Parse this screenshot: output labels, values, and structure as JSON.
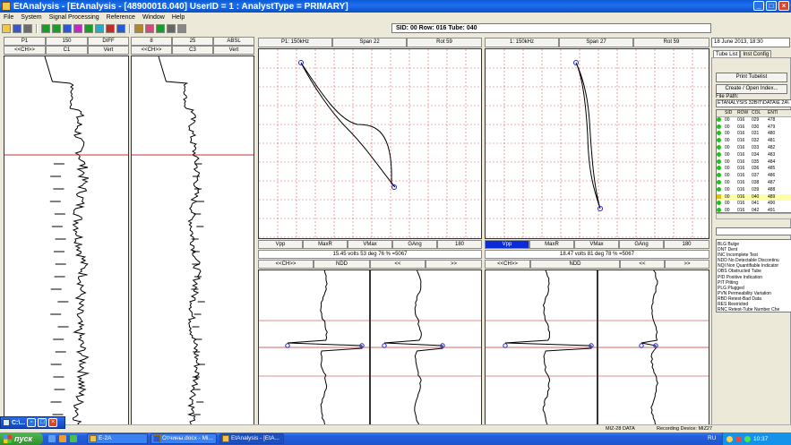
{
  "window": {
    "title": "EtAnalysis - [EtAnalysis - [48900016.040]      UserID = 1 : AnalystType = PRIMARY]",
    "min": "_",
    "max": "□",
    "close": "×"
  },
  "menu": [
    "File",
    "System",
    "Signal Processing",
    "Reference",
    "Window",
    "Help"
  ],
  "toolbar_icons": [
    {
      "name": "open-icon",
      "color": "#f2c84a"
    },
    {
      "name": "save-icon",
      "color": "#3a57c2"
    },
    {
      "name": "print-icon",
      "color": "#6b6b6b"
    },
    {
      "name": "config-c-icon",
      "color": "#1b9c2a"
    },
    {
      "name": "config-d-icon",
      "color": "#1b9c2a"
    },
    {
      "name": "config-h-icon",
      "color": "#2a59d6"
    },
    {
      "name": "config-m-icon",
      "color": "#c22bc2"
    },
    {
      "name": "filter-l-icon",
      "color": "#1b9c2a"
    },
    {
      "name": "filter-s-icon",
      "color": "#2aa9c4"
    },
    {
      "name": "filter-r-icon",
      "color": "#c22b2b"
    },
    {
      "name": "mix-icon",
      "color": "#2a59d6"
    },
    {
      "name": "chart-icon",
      "color": "#b8862a"
    },
    {
      "name": "palette-icon",
      "color": "#d24a7a"
    },
    {
      "name": "grid-icon",
      "color": "#1b9c2a"
    },
    {
      "name": "tool-icon",
      "color": "#666666"
    },
    {
      "name": "wrench-icon",
      "color": "#888888"
    }
  ],
  "status": {
    "sid": "SID: 00   Row: 016   Tube: 040",
    "datetime": "18 June 2013, 18:30"
  },
  "strip1": {
    "c1": "P1",
    "c2": "150",
    "c3": "DIFF",
    "r1": "<<CH>>",
    "r2": "C1",
    "r3": "Vert"
  },
  "strip2": {
    "c1": "8",
    "c2": "25",
    "c3": "ABSL",
    "r1": "<<CH>>",
    "r2": "C3",
    "r3": "Vert"
  },
  "lissa1": {
    "h1": "P1: 150kHz",
    "h2": "Span 22",
    "h3": "Rot 59",
    "m1": "Vpp",
    "m2": "MaxR",
    "m3": "VMax",
    "m4": "GAng",
    "m5": "180",
    "readout": "15.45 volts  53 deg  76 % =5067",
    "n1": "<<CH>>",
    "n2": "NDD",
    "n3": "<<",
    "n4": ">>"
  },
  "lissa2": {
    "h1": "1: 150kHz",
    "h2": "Span 27",
    "h3": "Rot 59",
    "m1": "Vpp",
    "m2": "MaxR",
    "m3": "VMax",
    "m4": "GAng",
    "m5": "180",
    "readout": "18.47 volts  81 deg  78 % =5067",
    "n1": "<<CH>>",
    "n2": "NDD",
    "n3": "<<",
    "n4": ">>"
  },
  "side": {
    "tab1": "Tube List",
    "tab2": "Inst Config",
    "btn_print": "Print Tubelist",
    "btn_create": "Create / Open Index...",
    "file_path_label": "File Path:",
    "file_path": "ETANALYSIS 32BIT\\DATA\\E 2A\\",
    "columns": [
      "SID",
      "ROW",
      "COL",
      "ENTI"
    ],
    "rows": [
      [
        "00",
        "016",
        "029",
        "478"
      ],
      [
        "00",
        "016",
        "030",
        "479"
      ],
      [
        "00",
        "016",
        "031",
        "480"
      ],
      [
        "00",
        "016",
        "032",
        "481"
      ],
      [
        "00",
        "016",
        "033",
        "482"
      ],
      [
        "00",
        "016",
        "034",
        "483"
      ],
      [
        "00",
        "016",
        "035",
        "484"
      ],
      [
        "00",
        "016",
        "036",
        "485"
      ],
      [
        "00",
        "016",
        "037",
        "486"
      ],
      [
        "00",
        "016",
        "038",
        "487"
      ],
      [
        "00",
        "016",
        "039",
        "488"
      ],
      [
        "00",
        "016",
        "040",
        "489"
      ],
      [
        "00",
        "016",
        "041",
        "490"
      ],
      [
        "00",
        "016",
        "042",
        "491"
      ]
    ],
    "codes": [
      "BLG  Bulge",
      "DNT  Dent",
      "INC  Incomplete Test",
      "NDD  No Detectable Discontinu",
      "NQI  Non Quantifiable Indicator",
      "OBS  Obstructed Tube",
      "PID  Positive Indication",
      "PIT  Pitting",
      "PLG  Plugged",
      "PVN  Permeability Variation",
      "RBD  Retest-Bad Data",
      "RES  Restricted",
      "RNC  Retest-Tube Number Che"
    ]
  },
  "statusbar": {
    "a": "MIZ-28 DATA",
    "b": "Recording Device: MIZ27"
  },
  "mini_window": {
    "label": "C:\\..."
  },
  "taskbar": {
    "start": "пуск",
    "items": [
      "E-2A",
      "Отчины.docx - Mi...",
      "EtAnalysis - [EtA..."
    ],
    "lang": "RU",
    "time": "10:37"
  }
}
